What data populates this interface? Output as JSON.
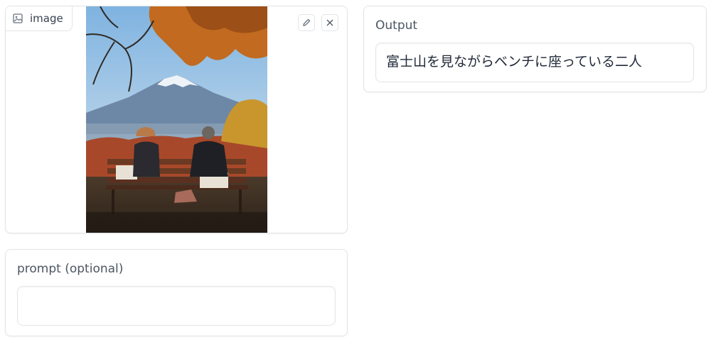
{
  "image_panel": {
    "label": "image",
    "icons": {
      "label": "image-icon",
      "edit": "pencil-icon",
      "clear": "close-icon"
    }
  },
  "prompt_panel": {
    "label": "prompt (optional)",
    "value": ""
  },
  "output_panel": {
    "label": "Output",
    "value": "富士山を見ながらベンチに座っている二人"
  }
}
